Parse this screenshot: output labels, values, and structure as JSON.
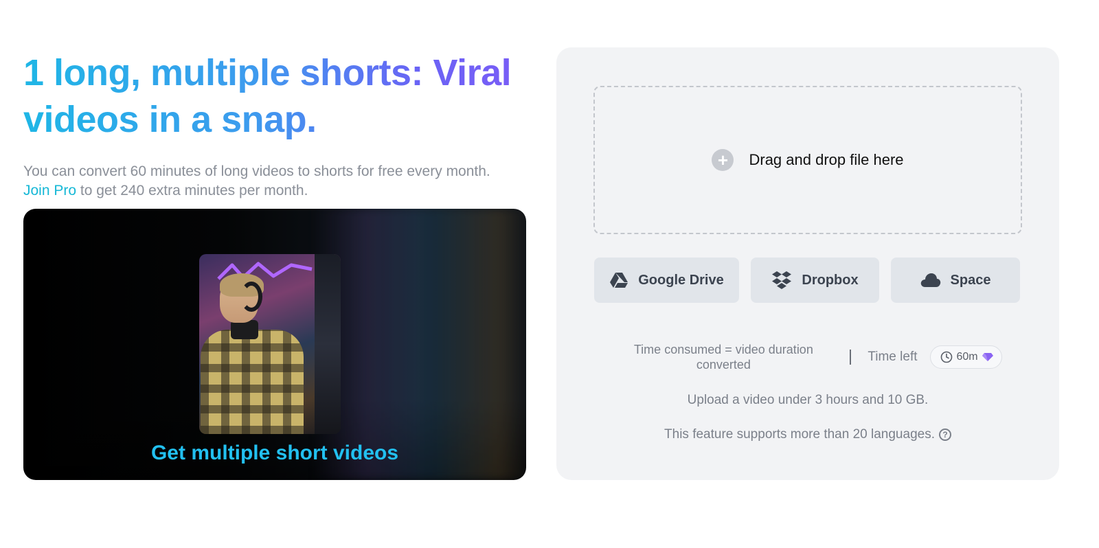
{
  "hero": {
    "headline": "1 long, multiple shorts: Viral videos in a snap.",
    "subtitle_part1": "You can convert 60 minutes of long videos to shorts for free every month. ",
    "join_pro": "Join Pro",
    "subtitle_part2": " to get 240 extra minutes per month."
  },
  "preview": {
    "caption": "Get multiple short videos"
  },
  "upload": {
    "dropzone_label": "Drag and drop file here",
    "sources": [
      {
        "label": "Google Drive",
        "icon": "google-drive-icon"
      },
      {
        "label": "Dropbox",
        "icon": "dropbox-icon"
      },
      {
        "label": "Space",
        "icon": "cloud-icon"
      }
    ],
    "time_consumed": "Time consumed = video duration converted",
    "time_left_label": "Time left",
    "time_left_value": "60m",
    "limit_note": "Upload a video under 3 hours and 10 GB.",
    "languages_note": "This feature supports more than 20 languages.",
    "help_symbol": "?"
  },
  "colors": {
    "accent_cyan": "#22c0f0",
    "accent_purple": "#7b5cf6",
    "link": "#16b8d6",
    "panel_bg": "#f2f3f5"
  }
}
